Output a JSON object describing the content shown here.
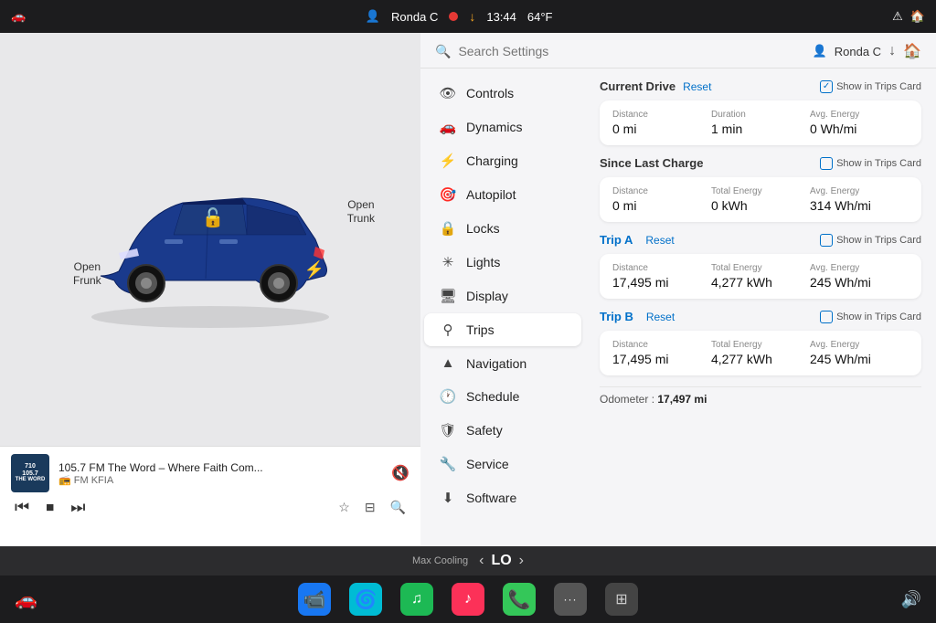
{
  "statusBar": {
    "leftIcon": "🚗",
    "user": "Ronda C",
    "recordDot": true,
    "downloadIcon": "↓",
    "time": "13:44",
    "temp": "64°F",
    "rightIcons": [
      "⚠",
      "🏠"
    ]
  },
  "search": {
    "placeholder": "Search Settings"
  },
  "userBar": {
    "user": "Ronda C",
    "icons": [
      "↓",
      "🏠"
    ]
  },
  "menu": {
    "items": [
      {
        "id": "controls",
        "icon": "👁",
        "label": "Controls"
      },
      {
        "id": "dynamics",
        "icon": "🚗",
        "label": "Dynamics"
      },
      {
        "id": "charging",
        "icon": "⚡",
        "label": "Charging"
      },
      {
        "id": "autopilot",
        "icon": "🎯",
        "label": "Autopilot"
      },
      {
        "id": "locks",
        "icon": "🔒",
        "label": "Locks"
      },
      {
        "id": "lights",
        "icon": "💡",
        "label": "Lights"
      },
      {
        "id": "display",
        "icon": "🖥",
        "label": "Display"
      },
      {
        "id": "trips",
        "icon": "📍",
        "label": "Trips",
        "active": true
      },
      {
        "id": "navigation",
        "icon": "▲",
        "label": "Navigation"
      },
      {
        "id": "schedule",
        "icon": "🕐",
        "label": "Schedule"
      },
      {
        "id": "safety",
        "icon": "🛡",
        "label": "Safety"
      },
      {
        "id": "service",
        "icon": "🔧",
        "label": "Service"
      },
      {
        "id": "software",
        "icon": "⬇",
        "label": "Software"
      }
    ]
  },
  "tripsData": {
    "currentDrive": {
      "title": "Current Drive",
      "resetLabel": "Reset",
      "showTrips": "Show in Trips Card",
      "distance": {
        "label": "Distance",
        "value": "0 mi"
      },
      "duration": {
        "label": "Duration",
        "value": "1 min"
      },
      "avgEnergy": {
        "label": "Avg. Energy",
        "value": "0 Wh/mi"
      }
    },
    "sinceLastCharge": {
      "title": "Since Last Charge",
      "showTrips": "Show in Trips Card",
      "distance": {
        "label": "Distance",
        "value": "0 mi"
      },
      "totalEnergy": {
        "label": "Total Energy",
        "value": "0 kWh"
      },
      "avgEnergy": {
        "label": "Avg. Energy",
        "value": "314 Wh/mi"
      }
    },
    "tripA": {
      "title": "Trip A",
      "resetLabel": "Reset",
      "showTrips": "Show in Trips Card",
      "distance": {
        "label": "Distance",
        "value": "17,495 mi"
      },
      "totalEnergy": {
        "label": "Total Energy",
        "value": "4,277 kWh"
      },
      "avgEnergy": {
        "label": "Avg. Energy",
        "value": "245 Wh/mi"
      }
    },
    "tripB": {
      "title": "Trip B",
      "resetLabel": "Reset",
      "showTrips": "Show in Trips Card",
      "distance": {
        "label": "Distance",
        "value": "17,495 mi"
      },
      "totalEnergy": {
        "label": "Total Energy",
        "value": "4,277 kWh"
      },
      "avgEnergy": {
        "label": "Avg. Energy",
        "value": "245 Wh/mi"
      }
    },
    "odometer": {
      "label": "Odometer :",
      "value": "17,497 mi"
    }
  },
  "car": {
    "openFrunk": "Open\nFrunk",
    "openTrunk": "Open\nTrunk"
  },
  "media": {
    "logoLine1": "710",
    "logoLine2": "105.7",
    "logoLine3": "THE WORD",
    "title": "105.7 FM The Word – Where Faith Com...",
    "station": "FM KFIA",
    "controls": [
      "⏮",
      "⏹",
      "⏭"
    ]
  },
  "climate": {
    "label": "Max Cooling",
    "value": "LO"
  },
  "taskbar": {
    "apps": [
      {
        "id": "camera",
        "color": "blue",
        "icon": "📹"
      },
      {
        "id": "fan",
        "color": "teal",
        "icon": "🌀"
      },
      {
        "id": "spotify",
        "color": "green",
        "icon": "♫"
      },
      {
        "id": "music",
        "color": "red",
        "icon": "♪"
      },
      {
        "id": "phone",
        "color": "green2",
        "icon": "📞"
      },
      {
        "id": "more",
        "color": "gray",
        "icon": "···"
      },
      {
        "id": "grid",
        "color": "gray2",
        "icon": "⊞"
      }
    ]
  }
}
